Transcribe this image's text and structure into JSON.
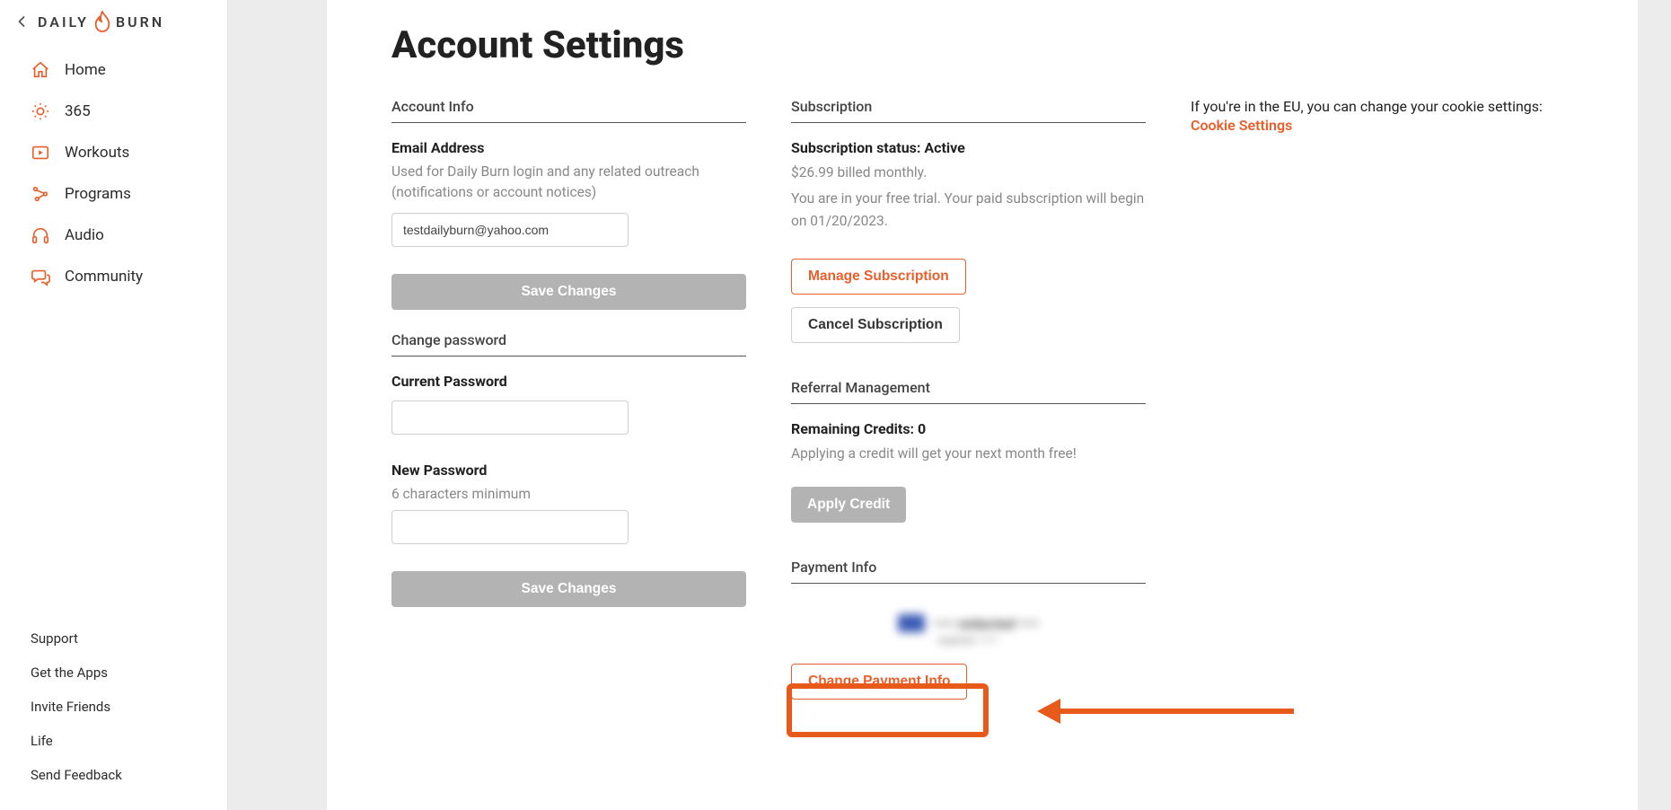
{
  "brand_left": "DAILY",
  "brand_right": "BURN",
  "sidebar": {
    "items": [
      {
        "label": "Home"
      },
      {
        "label": "365"
      },
      {
        "label": "Workouts"
      },
      {
        "label": "Programs"
      },
      {
        "label": "Audio"
      },
      {
        "label": "Community"
      }
    ],
    "bottom": [
      {
        "label": "Support"
      },
      {
        "label": "Get the Apps"
      },
      {
        "label": "Invite Friends"
      },
      {
        "label": "Life"
      },
      {
        "label": "Send Feedback"
      }
    ]
  },
  "page_title": "Account Settings",
  "account_info": {
    "heading": "Account Info",
    "email_label": "Email Address",
    "email_help": "Used for Daily Burn login and any related outreach (notifications or account notices)",
    "email_value": "testdailyburn@yahoo.com",
    "save_label": "Save Changes"
  },
  "change_password": {
    "heading": "Change password",
    "current_label": "Current Password",
    "new_label": "New Password",
    "new_help": "6 characters minimum",
    "save_label": "Save Changes"
  },
  "subscription": {
    "heading": "Subscription",
    "status_label": "Subscription status: ",
    "status_value": "Active",
    "billing_line": "$26.99 billed monthly.",
    "trial_line": "You are in your free trial. Your paid subscription will begin on 01/20/2023.",
    "manage_label": "Manage Subscription",
    "cancel_label": "Cancel Subscription"
  },
  "referral": {
    "heading": "Referral Management",
    "credits_label": "Remaining Credits: ",
    "credits_value": "0",
    "credit_help": "Applying a credit will get your next month free!",
    "apply_label": "Apply Credit"
  },
  "payment": {
    "heading": "Payment Info",
    "change_label": "Change Payment Info"
  },
  "eu_notice": {
    "text": "If you're in the EU, you can change your cookie settings:",
    "link": "Cookie Settings"
  }
}
